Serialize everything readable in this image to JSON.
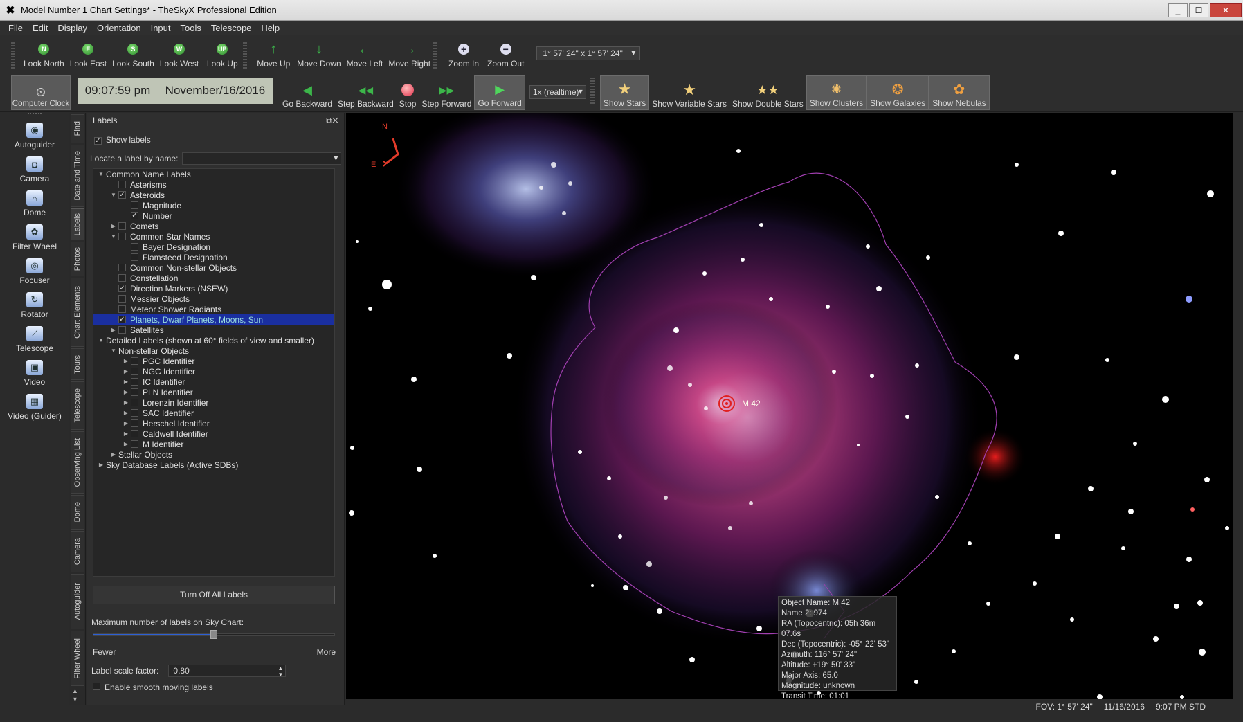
{
  "window": {
    "title": "Model Number 1 Chart Settings* - TheSkyX Professional Edition",
    "min": "_",
    "max": "☐",
    "close": "✕"
  },
  "menu": [
    "File",
    "Edit",
    "Display",
    "Orientation",
    "Input",
    "Tools",
    "Telescope",
    "Help"
  ],
  "toolbar1": {
    "look": [
      {
        "label": "Look North",
        "glyph": "N"
      },
      {
        "label": "Look East",
        "glyph": "E"
      },
      {
        "label": "Look South",
        "glyph": "S"
      },
      {
        "label": "Look West",
        "glyph": "W"
      },
      {
        "label": "Look Up",
        "glyph": "UP"
      }
    ],
    "move": [
      {
        "label": "Move Up",
        "glyph": "↑"
      },
      {
        "label": "Move Down",
        "glyph": "↓"
      },
      {
        "label": "Move Left",
        "glyph": "←"
      },
      {
        "label": "Move Right",
        "glyph": "→"
      }
    ],
    "zoom_in": "Zoom In",
    "zoom_out": "Zoom Out",
    "fov": "1° 57' 24\" x 1° 57' 24\""
  },
  "toolbar2": {
    "computer_clock": "Computer Clock",
    "time": "09:07:59 pm",
    "date": "November/16/2016",
    "go_backward": "Go Backward",
    "step_backward": "Step Backward",
    "stop": "Stop",
    "step_forward": "Step Forward",
    "go_forward": "Go Forward",
    "rate": "1x (realtime)",
    "show_stars": "Show Stars",
    "show_variable_stars": "Show Variable Stars",
    "show_double_stars": "Show Double Stars",
    "show_clusters": "Show Clusters",
    "show_galaxies": "Show Galaxies",
    "show_nebulas": "Show Nebulas"
  },
  "left_tools": [
    "Autoguider",
    "Camera",
    "Dome",
    "Filter Wheel",
    "Focuser",
    "Rotator",
    "Telescope",
    "Video",
    "Video (Guider)"
  ],
  "vertical_tabs": [
    "Find",
    "Date and Time",
    "Labels",
    "Photos",
    "Chart Elements",
    "Tours",
    "Telescope",
    "Observing List",
    "Dome",
    "Camera",
    "Autoguider",
    "Filter Wheel"
  ],
  "labels_panel": {
    "title": "Labels",
    "show_labels": "Show labels",
    "locate": "Locate a label by name:",
    "tree": [
      {
        "indent": 0,
        "tw": "▼",
        "chk": "none",
        "text": "Common Name Labels"
      },
      {
        "indent": 1,
        "tw": "",
        "chk": "off",
        "text": "Asterisms"
      },
      {
        "indent": 1,
        "tw": "▼",
        "chk": "on",
        "text": "Asteroids"
      },
      {
        "indent": 2,
        "tw": "",
        "chk": "off",
        "text": "Magnitude"
      },
      {
        "indent": 2,
        "tw": "",
        "chk": "on",
        "text": "Number"
      },
      {
        "indent": 1,
        "tw": "▶",
        "chk": "off",
        "text": "Comets"
      },
      {
        "indent": 1,
        "tw": "▼",
        "chk": "off",
        "text": "Common Star Names"
      },
      {
        "indent": 2,
        "tw": "",
        "chk": "off",
        "text": "Bayer Designation"
      },
      {
        "indent": 2,
        "tw": "",
        "chk": "off",
        "text": "Flamsteed Designation"
      },
      {
        "indent": 1,
        "tw": "",
        "chk": "off",
        "text": "Common Non-stellar Objects"
      },
      {
        "indent": 1,
        "tw": "",
        "chk": "off",
        "text": "Constellation"
      },
      {
        "indent": 1,
        "tw": "",
        "chk": "on",
        "text": "Direction Markers (NSEW)"
      },
      {
        "indent": 1,
        "tw": "",
        "chk": "off",
        "text": "Messier Objects"
      },
      {
        "indent": 1,
        "tw": "",
        "chk": "off",
        "text": "Meteor Shower Radiants"
      },
      {
        "indent": 1,
        "tw": "",
        "chk": "on",
        "text": "Planets, Dwarf Planets, Moons, Sun",
        "selected": true
      },
      {
        "indent": 1,
        "tw": "▶",
        "chk": "off",
        "text": "Satellites"
      },
      {
        "indent": 0,
        "tw": "▼",
        "chk": "none",
        "text": "Detailed Labels (shown at 60° fields of view and smaller)"
      },
      {
        "indent": 1,
        "tw": "▼",
        "chk": "none",
        "text": "Non-stellar Objects"
      },
      {
        "indent": 2,
        "tw": "▶",
        "chk": "off",
        "text": "PGC Identifier"
      },
      {
        "indent": 2,
        "tw": "▶",
        "chk": "off",
        "text": "NGC Identifier"
      },
      {
        "indent": 2,
        "tw": "▶",
        "chk": "off",
        "text": "IC Identifier"
      },
      {
        "indent": 2,
        "tw": "▶",
        "chk": "off",
        "text": "PLN Identifier"
      },
      {
        "indent": 2,
        "tw": "▶",
        "chk": "off",
        "text": "Lorenzin Identifier"
      },
      {
        "indent": 2,
        "tw": "▶",
        "chk": "off",
        "text": "SAC Identifier"
      },
      {
        "indent": 2,
        "tw": "▶",
        "chk": "off",
        "text": "Herschel Identifier"
      },
      {
        "indent": 2,
        "tw": "▶",
        "chk": "off",
        "text": "Caldwell Identifier"
      },
      {
        "indent": 2,
        "tw": "▶",
        "chk": "off",
        "text": "M Identifier"
      },
      {
        "indent": 1,
        "tw": "▶",
        "chk": "none",
        "text": "Stellar Objects"
      },
      {
        "indent": 0,
        "tw": "▶",
        "chk": "none",
        "text": "Sky Database Labels (Active SDBs)"
      }
    ],
    "turn_off": "Turn Off All Labels",
    "max_labels": "Maximum number of labels on Sky Chart:",
    "max_level": 0.5,
    "fewer": "Fewer",
    "more": "More",
    "scale_label": "Label scale factor:",
    "scale_value": "0.80",
    "smooth": "Enable smooth moving labels"
  },
  "sky": {
    "north": "N",
    "east": "E",
    "object_label": "M 42",
    "info": [
      "Object Name: M 42",
      "Name 2: 974",
      "RA (Topocentric): 05h 36m 07.6s",
      "Dec (Topocentric): -05° 22' 53\"",
      "Azimuth: 116° 57' 24\"",
      "Altitude: +19° 50' 33\"",
      "Major Axis: 65.0",
      "Magnitude: unknown",
      "Transit Time: 01:01"
    ]
  },
  "status": {
    "fov": "FOV: 1° 57' 24\"",
    "date": "11/16/2016",
    "time": "9:07 PM STD"
  }
}
